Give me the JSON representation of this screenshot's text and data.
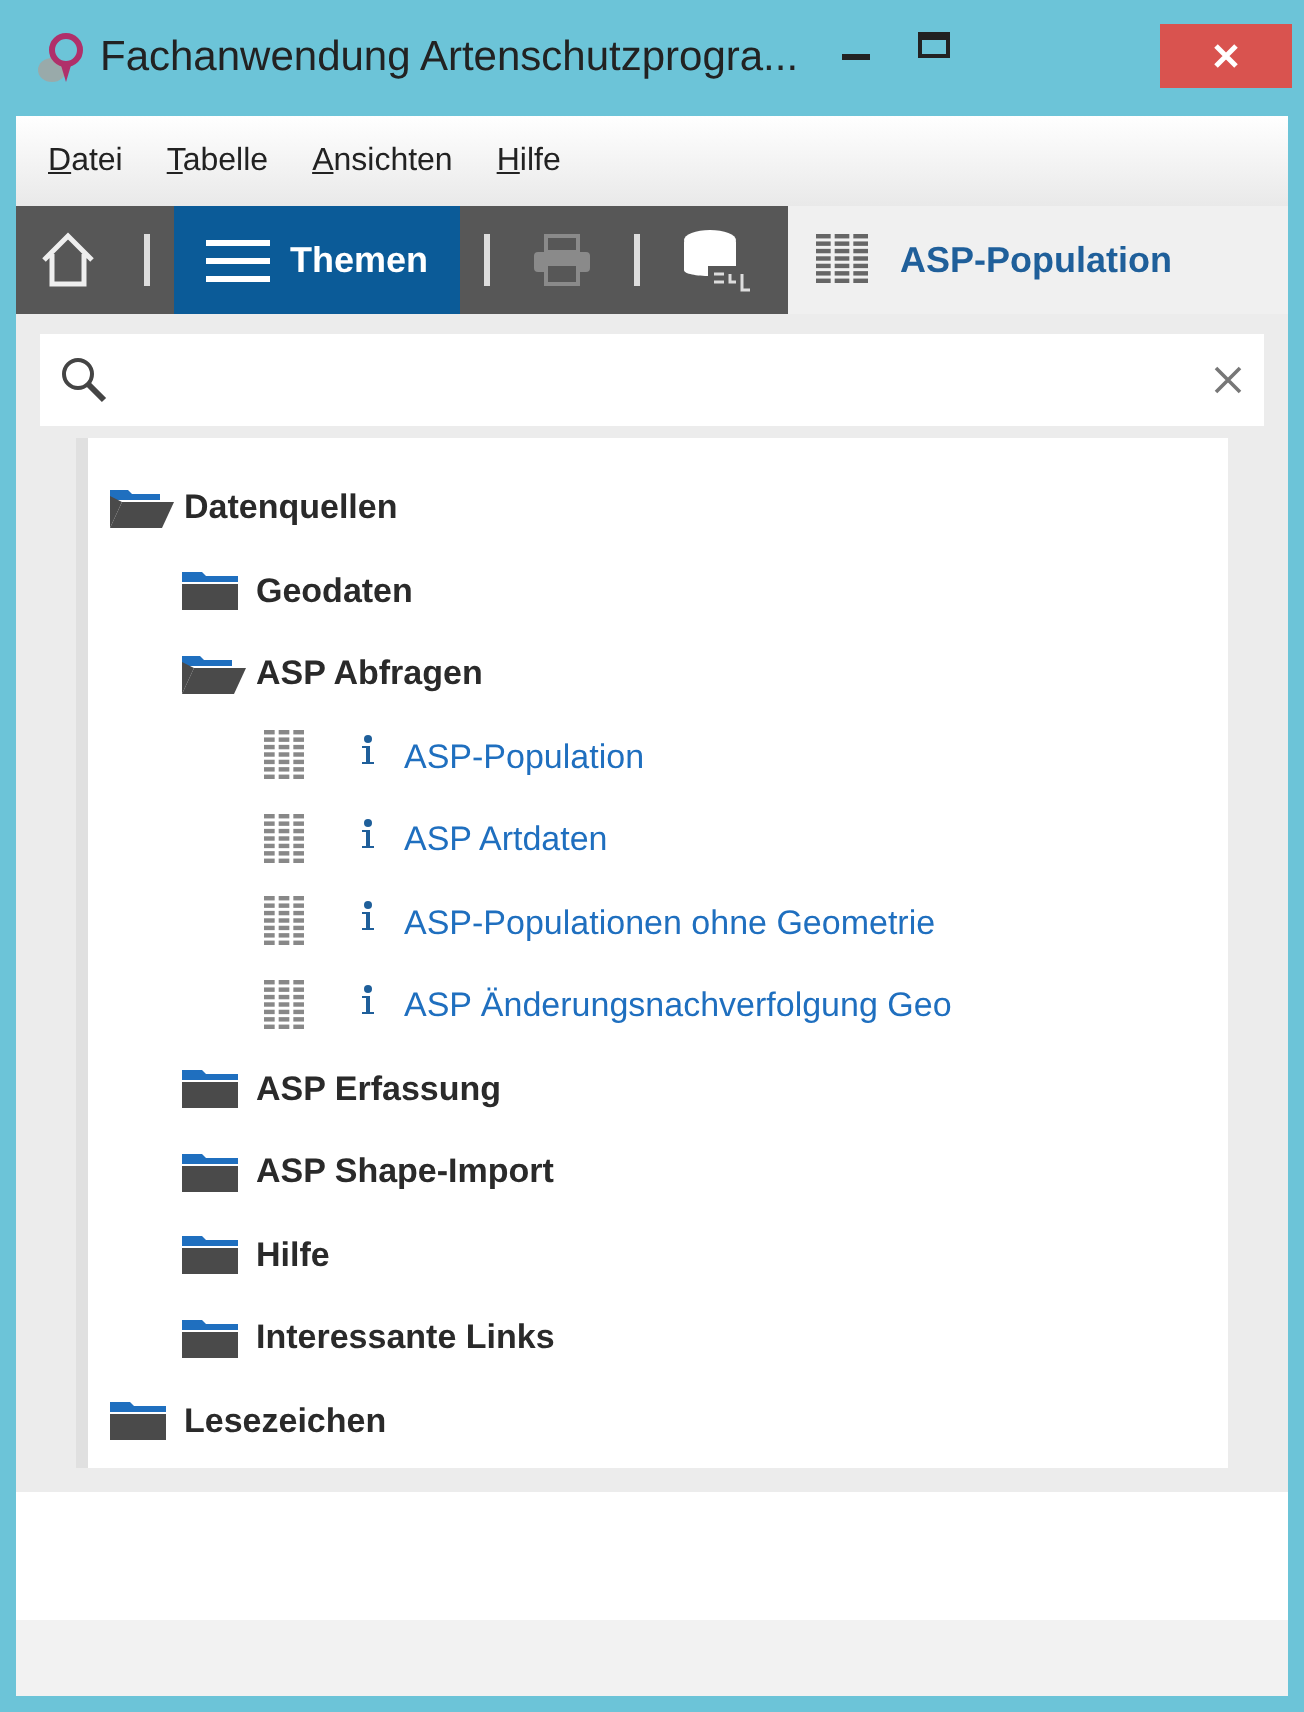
{
  "window": {
    "title": "Fachanwendung Artenschutzprogra..."
  },
  "menu": [
    "Datei",
    "Tabelle",
    "Ansichten",
    "Hilfe"
  ],
  "toolbar": [
    {
      "kind": "home"
    },
    {
      "kind": "themes",
      "label": "Themen",
      "selected": true
    },
    {
      "kind": "print",
      "disabled": true
    },
    {
      "kind": "sql"
    },
    {
      "kind": "tab",
      "label": "ASP-Population"
    }
  ],
  "tree": [
    {
      "kind": "folder",
      "label": "Datenquellen",
      "expanded": true,
      "children": [
        {
          "kind": "folder",
          "label": "Geodaten",
          "expanded": false
        },
        {
          "kind": "folder",
          "label": "ASP Abfragen",
          "expanded": true,
          "children": [
            {
              "kind": "query",
              "label": "ASP-Population"
            },
            {
              "kind": "query",
              "label": "ASP Artdaten"
            },
            {
              "kind": "query",
              "label": "ASP-Populationen ohne Geometrie"
            },
            {
              "kind": "query",
              "label": "ASP Änderungsnachverfolgung Geo"
            }
          ]
        },
        {
          "kind": "folder",
          "label": "ASP Erfassung",
          "expanded": false
        },
        {
          "kind": "folder",
          "label": "ASP Shape-Import",
          "expanded": false
        },
        {
          "kind": "folder",
          "label": "Hilfe",
          "expanded": false
        },
        {
          "kind": "folder",
          "label": "Interessante Links",
          "expanded": false
        }
      ]
    },
    {
      "kind": "folder",
      "label": "Lesezeichen",
      "expanded": false
    }
  ]
}
